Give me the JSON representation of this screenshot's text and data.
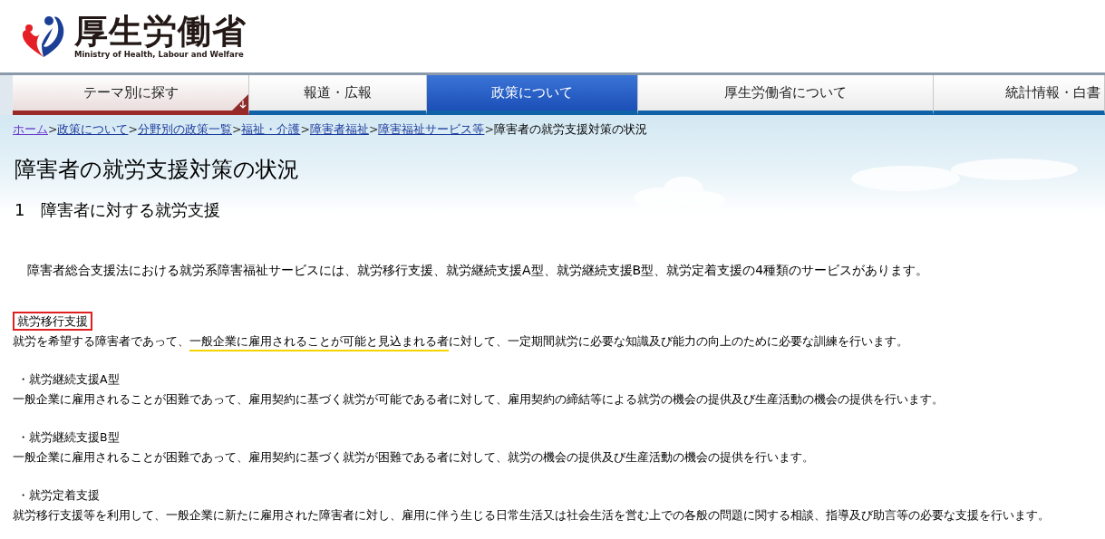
{
  "header": {
    "logo_title": "厚生労働省",
    "logo_subtitle": "Ministry of Health, Labour and Welfare"
  },
  "nav_tabs": [
    {
      "label": "テーマ別に探す",
      "kind": "dropdown",
      "selected": false
    },
    {
      "label": "報道・広報",
      "kind": "plain",
      "selected": false
    },
    {
      "label": "政策について",
      "kind": "plain",
      "selected": true
    },
    {
      "label": "厚生労働省について",
      "kind": "plain",
      "selected": false
    },
    {
      "label": "統計情報・白書",
      "kind": "plain",
      "selected": false
    }
  ],
  "breadcrumb": {
    "links": [
      "ホーム",
      "政策について",
      "分野別の政策一覧",
      "福祉・介護",
      "障害者福祉",
      "障害福祉サービス等"
    ],
    "separator": ">",
    "current": "障害者の就労支援対策の状況"
  },
  "page_title": "障害者の就労支援対策の状況",
  "section_heading": "1　障害者に対する就労支援",
  "intro": "障害者総合支援法における就労系障害福祉サービスには、就労移行支援、就労継続支援A型、就労継続支援B型、就労定着支援の4種類のサービスがあります。",
  "services": [
    {
      "heading": "就労移行支援",
      "boxed": true,
      "text_before": "就労を希望する障害者であって、",
      "underlined": "一般企業に雇用されることが可能と見込まれる者",
      "text_after": "に対して、一定期間就労に必要な知識及び能力の向上のために必要な訓練を行います。"
    },
    {
      "heading": "・就労継続支援A型",
      "boxed": false,
      "text_before": "一般企業に雇用されることが困難であって、雇用契約に基づく就労が可能である者に対して、雇用契約の締結等による就労の機会の提供及び生産活動の機会の提供を行います。"
    },
    {
      "heading": "・就労継続支援B型",
      "boxed": false,
      "text_before": "一般企業に雇用されることが困難であって、雇用契約に基づく就労が困難である者に対して、就労の機会の提供及び生産活動の機会の提供を行います。"
    },
    {
      "heading": "・就労定着支援",
      "boxed": false,
      "text_before": "就労移行支援等を利用して、一般企業に新たに雇用された障害者に対し、雇用に伴う生じる日常生活又は社会生活を営む上での各般の問題に関する相談、指導及び助言等の必要な支援を行います。"
    }
  ]
}
